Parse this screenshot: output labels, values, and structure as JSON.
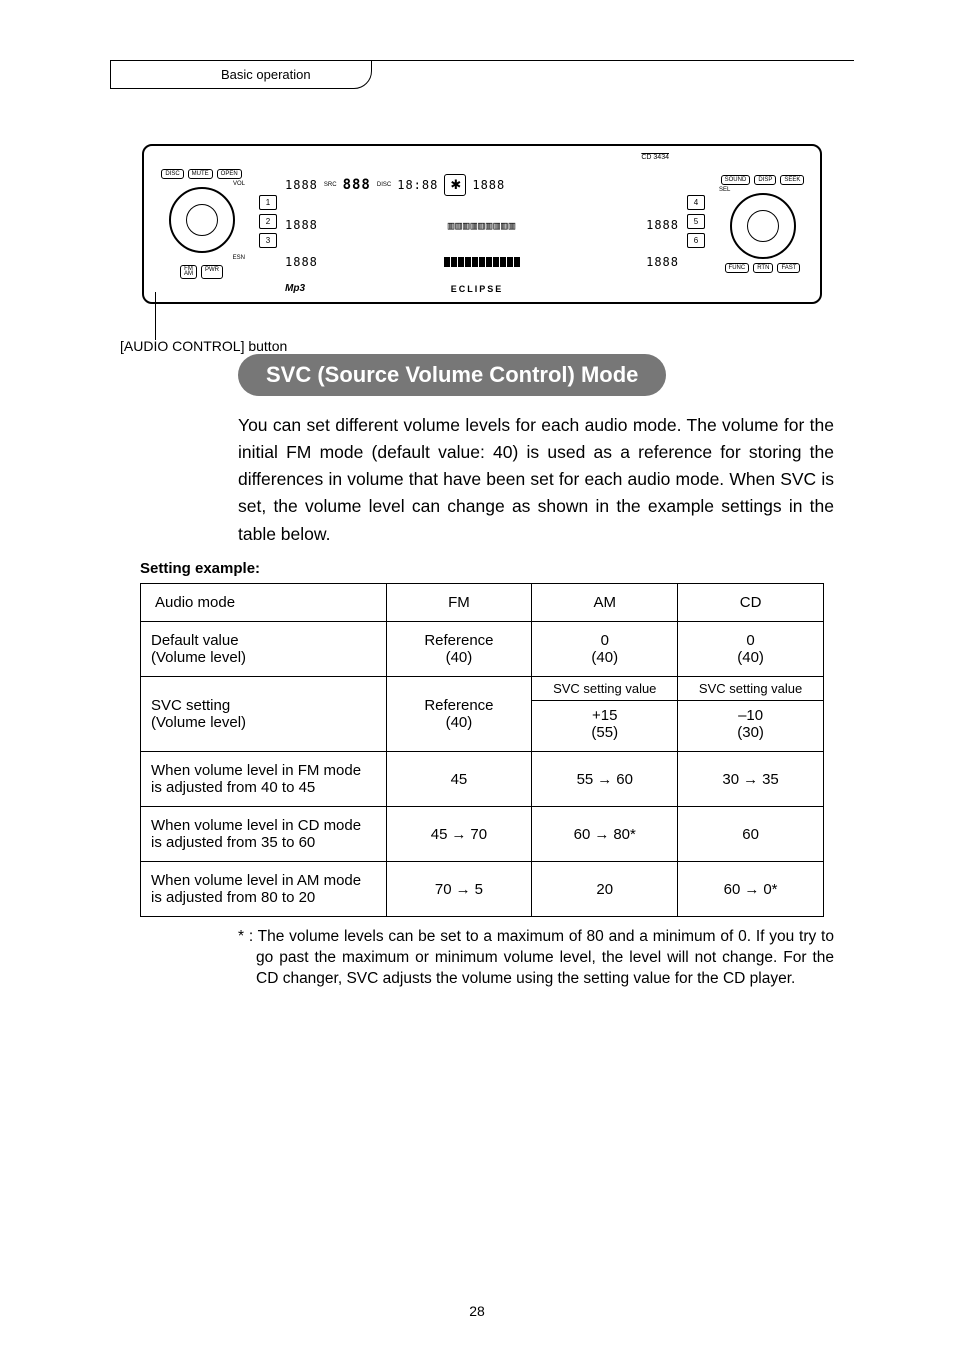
{
  "header": {
    "breadcrumb": "Basic operation"
  },
  "figure": {
    "callout": "[AUDIO CONTROL] button",
    "model": "CD 3434",
    "brand": "ECLIPSE",
    "btn_disc": "DISC",
    "btn_mute": "MUTE",
    "btn_open": "OPEN",
    "btn_sound": "SOUND",
    "btn_disp": "DISP",
    "btn_seek": "SEEK",
    "btn_sel": "SEL",
    "btn_func": "FUNC",
    "btn_rtn": "RTN",
    "btn_fast": "FAST",
    "btn_fm": "FM",
    "btn_am": "AM",
    "btn_pwr": "PWR",
    "btn_esn": "ESN",
    "btn_vol": "VOL",
    "mp3": "Mp3",
    "preset1": "1",
    "preset2": "2",
    "preset3": "3",
    "preset4": "4",
    "preset5": "5",
    "preset6": "6",
    "seg_time": "18:88",
    "seg_src": "SRC",
    "seg_disc": "DISC",
    "seg_888": "888",
    "seg_right": "1888"
  },
  "section": {
    "title": "SVC (Source Volume Control) Mode"
  },
  "intro": "You can set different volume levels for each audio mode. The volume for the initial FM mode (default value: 40) is used as a reference for storing the differences in volume that have been set for each audio mode. When SVC is set, the volume level can change as shown in the example settings in the table below.",
  "setting_label": "Setting example:",
  "table": {
    "head": {
      "c0": "Audio mode",
      "c1": "FM",
      "c2": "AM",
      "c3": "CD"
    },
    "row_default": {
      "label_l1": "Default value",
      "label_l2": "(Volume level)",
      "fm_l1": "Reference",
      "fm_l2": "(40)",
      "am_l1": "0",
      "am_l2": "(40)",
      "cd_l1": "0",
      "cd_l2": "(40)"
    },
    "row_svc": {
      "label_l1": "SVC setting",
      "label_l2": "(Volume level)",
      "fm_l1": "Reference",
      "fm_l2": "(40)",
      "am_top": "SVC setting value",
      "am_l1": "+15",
      "am_l2": "(55)",
      "cd_top": "SVC setting value",
      "cd_l1": "–10",
      "cd_l2": "(30)"
    },
    "row_a": {
      "label_l1": "When volume level in FM mode",
      "label_l2": "is adjusted from 40 to 45",
      "fm": "45",
      "am_from": "55",
      "am_to": "60",
      "cd_from": "30",
      "cd_to": "35"
    },
    "row_b": {
      "label_l1": "When volume level in CD mode",
      "label_l2": "is adjusted from 35 to 60",
      "fm_from": "45",
      "fm_to": "70",
      "am_from": "60",
      "am_to": "80*",
      "cd": "60"
    },
    "row_c": {
      "label_l1": "When volume level in AM mode",
      "label_l2": "is adjusted from 80 to 20",
      "fm_from": "70",
      "fm_to": "5",
      "am": "20",
      "cd_from": "60",
      "cd_to": "0*"
    }
  },
  "footnote": "* : The volume levels can be set to a maximum of 80 and a minimum of 0. If you try to go past the maximum or minimum volume level, the level will not change. For the CD changer, SVC adjusts the volume using the setting value for the CD player.",
  "page_number": "28",
  "icons": {
    "arrow": "→"
  }
}
